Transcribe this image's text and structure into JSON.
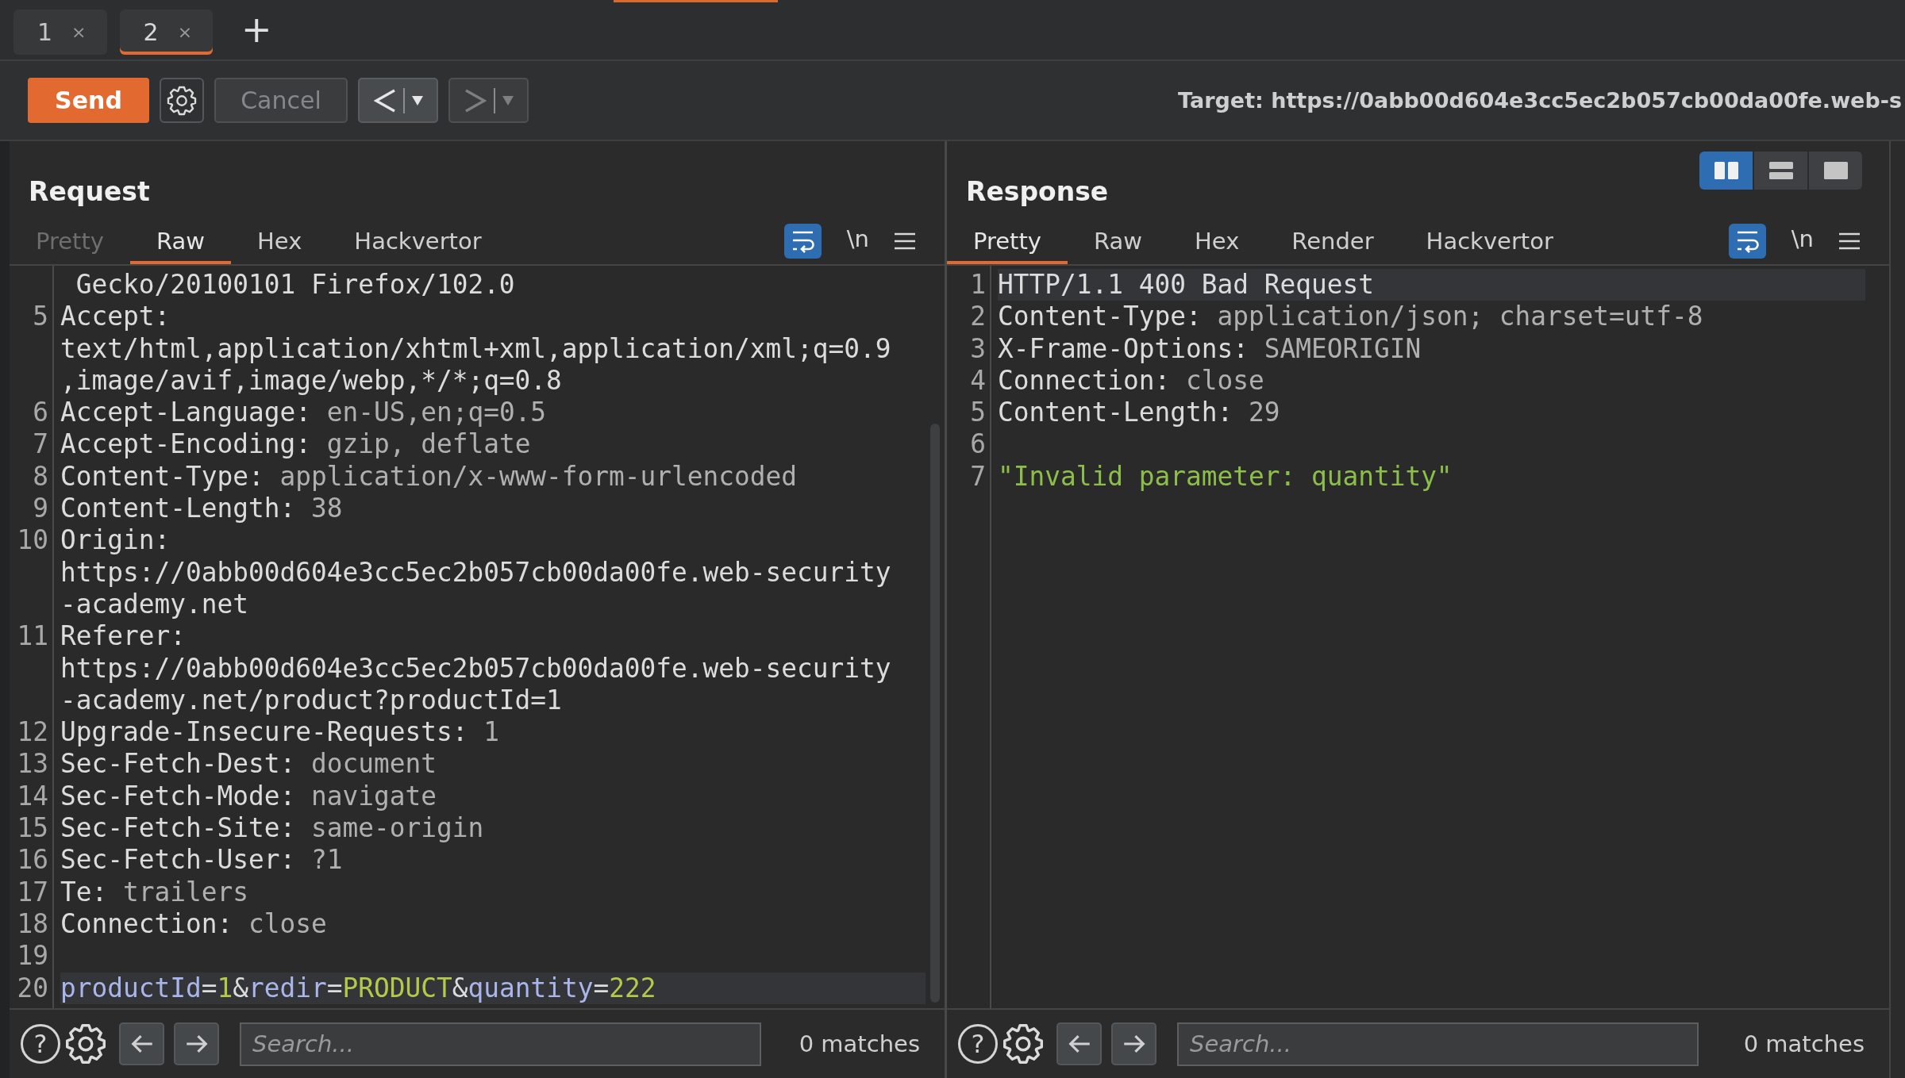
{
  "top_tabs": [
    {
      "label": "1",
      "close": "×",
      "selected": false
    },
    {
      "label": "2",
      "close": "×",
      "selected": true
    }
  ],
  "new_tab": "+",
  "toolbar": {
    "send": "Send",
    "cancel": {
      "label": "Cancel",
      "disabled": true
    },
    "back": {
      "disabled": false
    },
    "forward": {
      "disabled": true
    },
    "target": "Target: https://0abb00d604e3cc5ec2b057cb00da00fe.web-s"
  },
  "panels": [
    {
      "title": "Request",
      "tabs": [
        {
          "label": "Pretty",
          "selected": false,
          "disabled": true
        },
        {
          "label": "Raw",
          "selected": true,
          "disabled": false
        },
        {
          "label": "Hex",
          "selected": false,
          "disabled": false
        },
        {
          "label": "Hackvertor",
          "selected": false,
          "disabled": false
        }
      ],
      "word_wrap": true,
      "newline_toggle": "\\n",
      "scrollbar": true,
      "lines": [
        {
          "current": false,
          "rows": [
            [
              {
                "kind": "text",
                "text": " Gecko/20100101 Firefox/102.0"
              }
            ]
          ]
        },
        {
          "number": "5",
          "current": false,
          "rows": [
            [
              {
                "kind": "text",
                "text": "Accept:"
              }
            ],
            [
              {
                "kind": "text",
                "text": "text/html,application/xhtml+xml,application/xml;q=0.9"
              }
            ],
            [
              {
                "kind": "text",
                "text": ",image/avif,image/webp,*/*;q=0.8"
              }
            ]
          ]
        },
        {
          "number": "6",
          "current": false,
          "rows": [
            [
              {
                "kind": "text",
                "text": "Accept-Language:"
              },
              {
                "kind": "value",
                "text": " en-US,en;q=0.5"
              }
            ]
          ]
        },
        {
          "number": "7",
          "current": false,
          "rows": [
            [
              {
                "kind": "text",
                "text": "Accept-Encoding:"
              },
              {
                "kind": "value",
                "text": " gzip, deflate"
              }
            ]
          ]
        },
        {
          "number": "8",
          "current": false,
          "rows": [
            [
              {
                "kind": "text",
                "text": "Content-Type:"
              },
              {
                "kind": "value",
                "text": " application/x-www-form-urlencoded"
              }
            ]
          ]
        },
        {
          "number": "9",
          "current": false,
          "rows": [
            [
              {
                "kind": "text",
                "text": "Content-Length:"
              },
              {
                "kind": "value",
                "text": " 38"
              }
            ]
          ]
        },
        {
          "number": "10",
          "current": false,
          "rows": [
            [
              {
                "kind": "text",
                "text": "Origin:"
              }
            ],
            [
              {
                "kind": "text",
                "text": "https://0abb00d604e3cc5ec2b057cb00da00fe.web-security"
              }
            ],
            [
              {
                "kind": "text",
                "text": "-academy.net"
              }
            ]
          ]
        },
        {
          "number": "11",
          "current": false,
          "rows": [
            [
              {
                "kind": "text",
                "text": "Referer:"
              }
            ],
            [
              {
                "kind": "text",
                "text": "https://0abb00d604e3cc5ec2b057cb00da00fe.web-security"
              }
            ],
            [
              {
                "kind": "text",
                "text": "-academy.net/product?productId=1"
              }
            ]
          ]
        },
        {
          "number": "12",
          "current": false,
          "rows": [
            [
              {
                "kind": "text",
                "text": "Upgrade-Insecure-Requests:"
              },
              {
                "kind": "value",
                "text": " 1"
              }
            ]
          ]
        },
        {
          "number": "13",
          "current": false,
          "rows": [
            [
              {
                "kind": "text",
                "text": "Sec-Fetch-Dest:"
              },
              {
                "kind": "value",
                "text": " document"
              }
            ]
          ]
        },
        {
          "number": "14",
          "current": false,
          "rows": [
            [
              {
                "kind": "text",
                "text": "Sec-Fetch-Mode:"
              },
              {
                "kind": "value",
                "text": " navigate"
              }
            ]
          ]
        },
        {
          "number": "15",
          "current": false,
          "rows": [
            [
              {
                "kind": "text",
                "text": "Sec-Fetch-Site:"
              },
              {
                "kind": "value",
                "text": " same-origin"
              }
            ]
          ]
        },
        {
          "number": "16",
          "current": false,
          "rows": [
            [
              {
                "kind": "text",
                "text": "Sec-Fetch-User:"
              },
              {
                "kind": "value",
                "text": " ?1"
              }
            ]
          ]
        },
        {
          "number": "17",
          "current": false,
          "rows": [
            [
              {
                "kind": "text",
                "text": "Te:"
              },
              {
                "kind": "value",
                "text": " trailers"
              }
            ]
          ]
        },
        {
          "number": "18",
          "current": false,
          "rows": [
            [
              {
                "kind": "text",
                "text": "Connection:"
              },
              {
                "kind": "value",
                "text": " close"
              }
            ]
          ]
        },
        {
          "number": "19",
          "current": false
        },
        {
          "number": "20",
          "current": true,
          "rows": [
            [
              {
                "kind": "param",
                "text": "productId"
              },
              {
                "kind": "text",
                "text": "="
              },
              {
                "kind": "param_value",
                "text": "1"
              },
              {
                "kind": "text",
                "text": "&"
              },
              {
                "kind": "param",
                "text": "redir"
              },
              {
                "kind": "text",
                "text": "="
              },
              {
                "kind": "param_value",
                "text": "PRODUCT"
              },
              {
                "kind": "text",
                "text": "&"
              },
              {
                "kind": "param",
                "text": "quantity"
              },
              {
                "kind": "text",
                "text": "="
              },
              {
                "kind": "param_value",
                "text": "222"
              }
            ]
          ]
        }
      ],
      "help": "?",
      "search": {
        "placeholder": "Search..."
      },
      "matches": "0 matches"
    },
    {
      "title": "Response",
      "layout_buttons": [
        {
          "kind": "columns",
          "selected": true
        },
        {
          "kind": "rows",
          "selected": false
        },
        {
          "kind": "single",
          "selected": false
        }
      ],
      "tabs": [
        {
          "label": "Pretty",
          "selected": true,
          "disabled": false
        },
        {
          "label": "Raw",
          "selected": false,
          "disabled": false
        },
        {
          "label": "Hex",
          "selected": false,
          "disabled": false
        },
        {
          "label": "Render",
          "selected": false,
          "disabled": false
        },
        {
          "label": "Hackvertor",
          "selected": false,
          "disabled": false
        }
      ],
      "word_wrap": true,
      "newline_toggle": "\\n",
      "lines": [
        {
          "number": "1",
          "current": true,
          "rows": [
            [
              {
                "kind": "text",
                "text": "HTTP/1.1 400 Bad Request"
              }
            ]
          ]
        },
        {
          "number": "2",
          "current": false,
          "rows": [
            [
              {
                "kind": "text",
                "text": "Content-Type:"
              },
              {
                "kind": "value",
                "text": " application/json; charset=utf-8"
              }
            ]
          ]
        },
        {
          "number": "3",
          "current": false,
          "rows": [
            [
              {
                "kind": "text",
                "text": "X-Frame-Options:"
              },
              {
                "kind": "value",
                "text": " SAMEORIGIN"
              }
            ]
          ]
        },
        {
          "number": "4",
          "current": false,
          "rows": [
            [
              {
                "kind": "text",
                "text": "Connection:"
              },
              {
                "kind": "value",
                "text": " close"
              }
            ]
          ]
        },
        {
          "number": "5",
          "current": false,
          "rows": [
            [
              {
                "kind": "text",
                "text": "Content-Length:"
              },
              {
                "kind": "value",
                "text": " 29"
              }
            ]
          ]
        },
        {
          "number": "6",
          "current": false
        },
        {
          "number": "7",
          "current": false,
          "rows": [
            [
              {
                "kind": "string",
                "text": "\"Invalid parameter: quantity\""
              }
            ]
          ]
        }
      ],
      "help": "?",
      "search": {
        "placeholder": "Search..."
      },
      "matches": "0 matches"
    }
  ]
}
